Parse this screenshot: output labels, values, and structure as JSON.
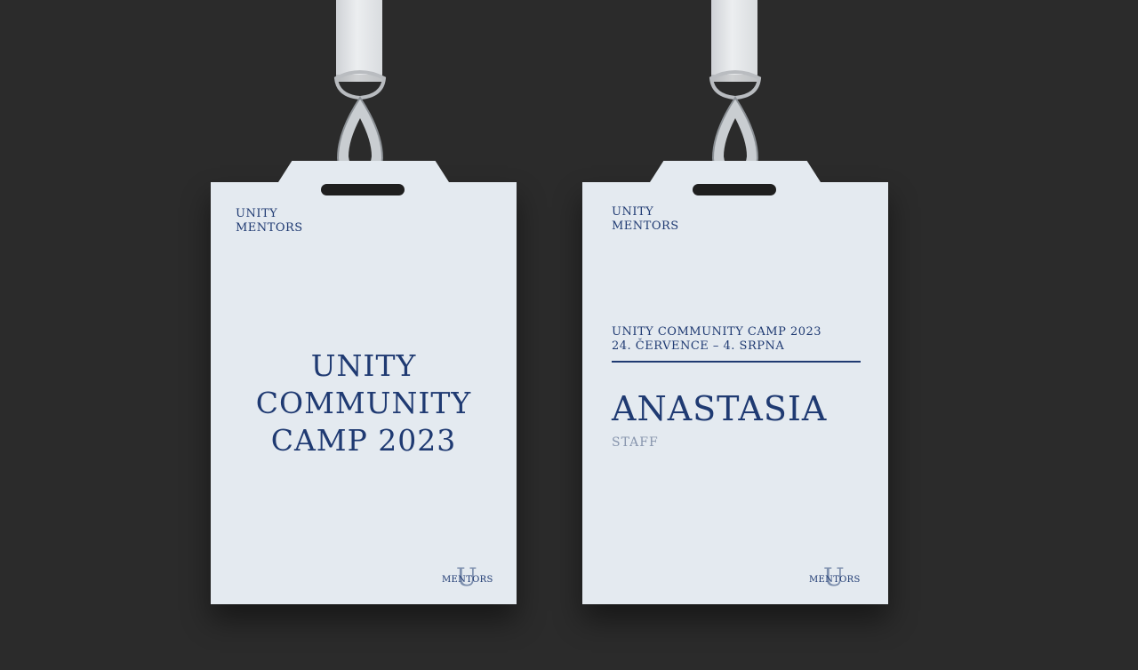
{
  "badge_front": {
    "brand_line1": "UNITY",
    "brand_line2": "MENTORS",
    "title_line1": "UNITY",
    "title_line2": "COMMUNITY",
    "title_line3": "CAMP 2023",
    "logo_letter": "U",
    "logo_text": "MENTORS"
  },
  "badge_back": {
    "brand_line1": "UNITY",
    "brand_line2": "MENTORS",
    "event_name": "UNITY COMMUNITY CAMP 2023",
    "event_dates": "24. ČERVENCE – 4. SRPNA",
    "person_name": "ANASTASIA",
    "person_role": "STAFF",
    "logo_letter": "U",
    "logo_text": "MENTORS"
  },
  "colors": {
    "background": "#2b2b2b",
    "card": "#e4eaf0",
    "navy": "#1f3a72",
    "muted": "#8795ad"
  }
}
